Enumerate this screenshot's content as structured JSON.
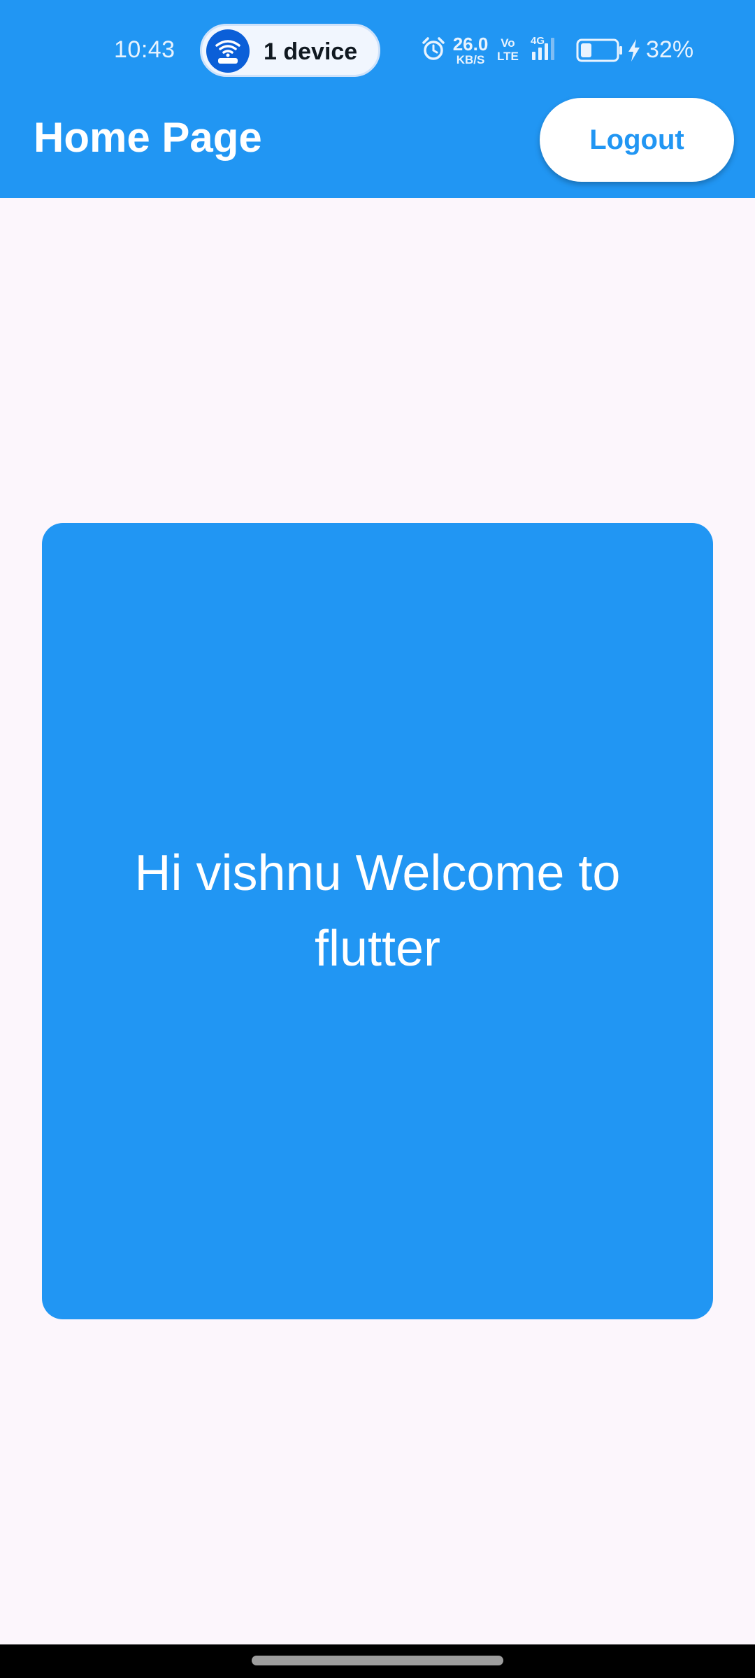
{
  "status_bar": {
    "time": "10:43",
    "hotspot": {
      "label": "1 device",
      "icon": "wifi-hotspot-icon"
    },
    "net_speed_value": "26.0",
    "net_speed_unit": "KB/S",
    "volte_top": "Vo",
    "volte_bottom": "LTE",
    "network_type": "4G",
    "battery_percent": "32%",
    "battery_level": 0.32,
    "charging": true,
    "alarm": true
  },
  "app_bar": {
    "title": "Home Page",
    "logout_label": "Logout"
  },
  "content": {
    "welcome_message": "Hi vishnu Welcome to flutter"
  },
  "colors": {
    "primary": "#2196f3",
    "background": "#fcf6fc",
    "on_primary": "#ffffff"
  }
}
